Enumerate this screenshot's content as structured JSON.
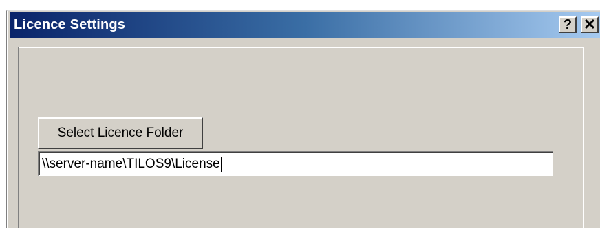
{
  "dialog": {
    "title": "Licence Settings",
    "help_label": "?",
    "close_label": "✕"
  },
  "licence": {
    "select_button_label": "Select Licence Folder",
    "path_value": "\\\\server-name\\TILOS9\\License"
  }
}
